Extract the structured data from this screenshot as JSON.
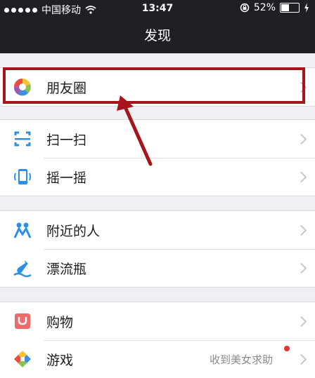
{
  "status": {
    "carrier": "中国移动",
    "time": "13:47",
    "battery": "52%",
    "battery_level": 0.52,
    "icons": [
      "signal-dots",
      "wifi-icon",
      "rotation-lock-icon",
      "battery-icon",
      "charging-icon"
    ]
  },
  "navbar": {
    "title": "发现"
  },
  "items": [
    {
      "label": "朋友圈",
      "icon": "moments-icon"
    },
    {
      "label": "扫一扫",
      "icon": "scan-icon"
    },
    {
      "label": "摇一摇",
      "icon": "shake-icon"
    },
    {
      "label": "附近的人",
      "icon": "people-nearby-icon"
    },
    {
      "label": "漂流瓶",
      "icon": "drift-bottle-icon"
    },
    {
      "label": "购物",
      "icon": "shopping-icon"
    },
    {
      "label": "游戏",
      "icon": "games-icon",
      "subtitle": "收到美女求助"
    }
  ],
  "colors": {
    "nav_bg": "#1f1f24",
    "annotation": "#a6151c",
    "background": "#efeff4"
  }
}
